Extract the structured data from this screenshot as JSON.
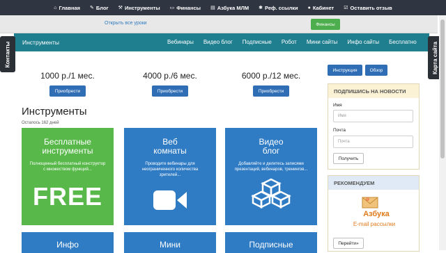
{
  "topnav": [
    {
      "icon": "home-icon",
      "glyph": "⌂",
      "label": "Главная"
    },
    {
      "icon": "pencil-icon",
      "glyph": "✎",
      "label": "Блог"
    },
    {
      "icon": "tools-icon",
      "glyph": "⚒",
      "label": "Инструменты"
    },
    {
      "icon": "money-icon",
      "glyph": "▭",
      "label": "Финансы"
    },
    {
      "icon": "book-icon",
      "glyph": "▤",
      "label": "Азбука МЛМ"
    },
    {
      "icon": "users-icon",
      "glyph": "✱",
      "label": "Реф. ссылки"
    },
    {
      "icon": "user-icon",
      "glyph": "●",
      "label": "Кабинет"
    },
    {
      "icon": "edit-icon",
      "glyph": "☑",
      "label": "Оставить отзыв"
    }
  ],
  "subbar": {
    "open_lessons": "Открыть все уроки",
    "finance_btn": "Финансы"
  },
  "mainnav": {
    "brand": "Инструменты",
    "links": [
      "Вебинары",
      "Видео блог",
      "Подписные",
      "Робот",
      "Мини сайты",
      "Инфо сайты",
      "Бесплатно"
    ]
  },
  "sidetabs": {
    "left": "Контакты",
    "right": "Карта сайта"
  },
  "prices": [
    {
      "amount": "1000 р./1 мес.",
      "button": "Приобрести"
    },
    {
      "amount": "4000 р./6 мес.",
      "button": "Приобрести"
    },
    {
      "amount": "6000 р./12 мес.",
      "button": "Приобрести"
    }
  ],
  "tools_heading": "Инструменты",
  "remaining": "Осталось 162 дней",
  "cards": [
    {
      "title": "Бесплатные инструменты",
      "desc": "Полноценный бесплатный конструктор с множеством функций...",
      "big": "FREE"
    },
    {
      "title": "Веб комнаты",
      "desc": "Проводите вебинары для неограниченного количества зрителей..."
    },
    {
      "title": "Видео блог",
      "desc": "Добавляйте и делитесь записями презентаций, вебинаров, тренингов..."
    }
  ],
  "cards_row2": [
    "Инфо",
    "Мини",
    "Подписные"
  ],
  "sidebar": {
    "btn_instruction": "Инструкция",
    "btn_review": "Обзор",
    "subscribe_title": "ПОДПИШИСЬ НА НОВОСТИ",
    "name_label": "Имя",
    "name_placeholder": "Имя",
    "email_label": "Почта",
    "email_placeholder": "Почта",
    "get_btn": "Получить",
    "recommend_title": "РЕКОМЕНДУЕМ",
    "promo_title": "Азбука",
    "promo_sub": "E-mail рассылки",
    "next_btn": "Перейти»"
  },
  "colors": {
    "topnav": "#2f3641",
    "mainnav": "#1f7f8f",
    "green": "#58b84a",
    "blue": "#2f7bc4",
    "btn": "#2f6eb5"
  }
}
